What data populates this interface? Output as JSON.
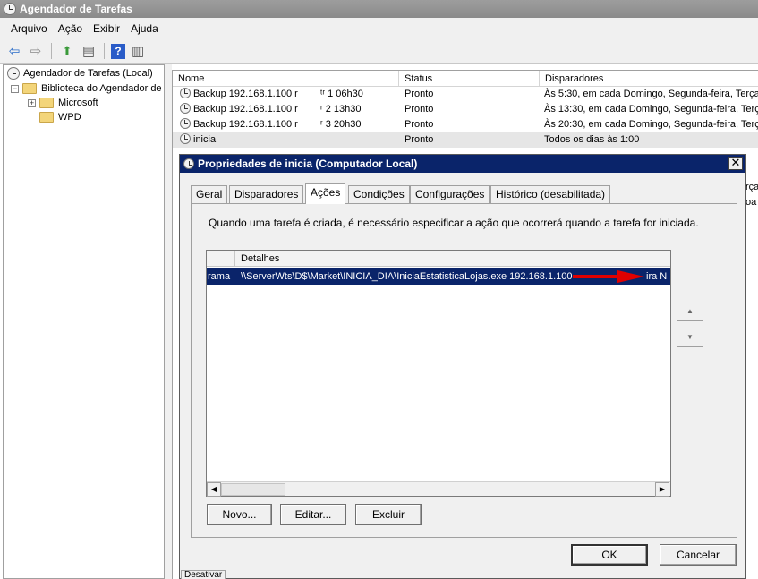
{
  "window": {
    "title": "Agendador de Tarefas"
  },
  "menu": {
    "items": [
      "Arquivo",
      "Ação",
      "Exibir",
      "Ajuda"
    ]
  },
  "toolbar": {
    "icons": [
      "back-arrow-icon",
      "forward-arrow-icon",
      "up-folder-icon",
      "show-hide-tree-icon",
      "help-icon",
      "show-hide-action-pane-icon"
    ],
    "back": "⇦",
    "forward": "⇨",
    "up": "⬆",
    "tree": "▤",
    "help": "?",
    "pane": "▥"
  },
  "tree": {
    "root": "Agendador de Tarefas (Local)",
    "library": "Biblioteca do Agendador de",
    "children": [
      "Microsoft",
      "WPD"
    ],
    "expand_minus": "−",
    "expand_plus": "+"
  },
  "list": {
    "columns": [
      "Nome",
      "Status",
      "Disparadores"
    ],
    "rows": [
      {
        "name": "Backup 192.168.1.100 r",
        "name_tail": "ᵗʳ 1 06h30",
        "status": "Pronto",
        "trigger": "Às 5:30, em cada Domingo, Segunda-feira, Terça-"
      },
      {
        "name": "Backup 192.168.1.100 r",
        "name_tail": "ʳ 2 13h30",
        "status": "Pronto",
        "trigger": "Às 13:30, em cada Domingo, Segunda-feira, Terç"
      },
      {
        "name": "Backup 192.168.1.100 r",
        "name_tail": "ʳ 3 20h30",
        "status": "Pronto",
        "trigger": "Às 20:30, em cada Domingo, Segunda-feira, Terç"
      },
      {
        "name": "inicia",
        "name_tail": "",
        "status": "Pronto",
        "trigger": "Todos os dias às 1:00"
      }
    ],
    "peek_right": [
      "rça",
      "oa"
    ]
  },
  "dialog": {
    "title": "Propriedades de inicia (Computador Local)",
    "close": "✕",
    "tabs": [
      "Geral",
      "Disparadores",
      "Ações",
      "Condições",
      "Configurações",
      "Histórico (desabilitada)"
    ],
    "active_tab": "Ações",
    "description": "Quando uma tarefa é criada, é necessário especificar a ação que ocorrerá quando a tarefa for iniciada.",
    "actions_table": {
      "header_detail": "Detalhes",
      "row": {
        "action": "rama",
        "details": "\\\\ServerWts\\D$\\Market\\INICIA_DIA\\IniciaEstatisticaLojas.exe 192.168.1.100 ",
        "details_tail": "ira N"
      }
    },
    "scroll": {
      "left": "◀",
      "right": "▶",
      "up": "▲",
      "down": "▼"
    },
    "buttons": {
      "new": "Novo...",
      "edit": "Editar...",
      "delete": "Excluir",
      "ok": "OK",
      "cancel": "Cancelar"
    },
    "arrow_color": "#e00000"
  },
  "status_bar": {
    "text": "Desativar"
  }
}
